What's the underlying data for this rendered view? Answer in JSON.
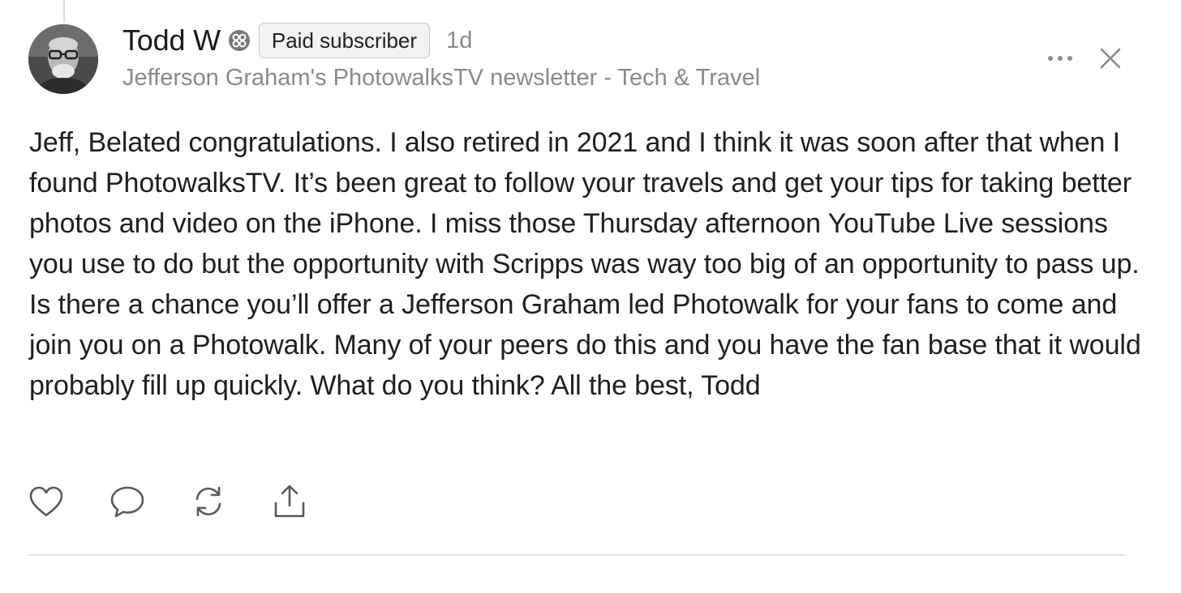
{
  "comment": {
    "author": {
      "name": "Todd W",
      "badge_label": "Paid subscriber",
      "avatar_icon": "avatar-image",
      "subscriber_icon": "paid-subscriber-badge-icon"
    },
    "time": "1d",
    "publication": "Jefferson Graham's PhotowalksTV newsletter - Tech & Travel",
    "body": "Jeff, Belated congratulations. I also retired in 2021 and I think it was soon after that when I found PhotowalksTV. It’s been great to follow your travels and get your tips for taking better photos and video on the iPhone. I miss those Thursday afternoon YouTube Live sessions you use to do but the opportunity with Scripps was way too big of an opportunity to pass up. Is there a chance you’ll offer a Jefferson Graham led Photowalk for your fans to come and join you on a Photowalk. Many of your peers do this and you have the fan base that it would probably fill up quickly. What do you think? All the best, Todd"
  },
  "controls": {
    "more_icon": "more-options-icon",
    "close_icon": "close-icon"
  },
  "actions": [
    {
      "name": "like",
      "icon": "heart-icon"
    },
    {
      "name": "reply",
      "icon": "speech-bubble-icon"
    },
    {
      "name": "restack",
      "icon": "restack-icon"
    },
    {
      "name": "share",
      "icon": "share-icon"
    }
  ],
  "colors": {
    "text": "#1f1f1f",
    "secondary_text": "#8a8a8a",
    "badge_background": "#f2f2f2",
    "divider": "#e2e2e2",
    "icon": "#5a5a5a"
  }
}
